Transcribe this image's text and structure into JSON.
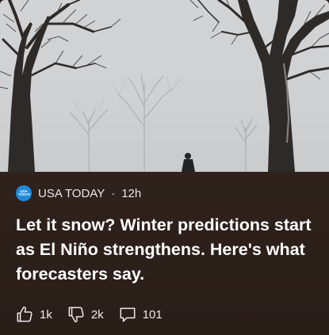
{
  "article": {
    "source_name": "USA TODAY",
    "separator": "·",
    "time_ago": "12h",
    "logo_text": "USA TODAY",
    "headline": "Let it snow? Winter predictions start as El Niño strengthens. Here's what forecasters say."
  },
  "actions": {
    "likes": "1k",
    "dislikes": "2k",
    "comments": "101"
  },
  "colors": {
    "logo_blue": "#1f8ad8",
    "panel_bg": "#2b1e19",
    "text": "#ffffff"
  },
  "icons": {
    "like": "thumbs-up-icon",
    "dislike": "thumbs-down-icon",
    "comment": "comment-icon"
  }
}
